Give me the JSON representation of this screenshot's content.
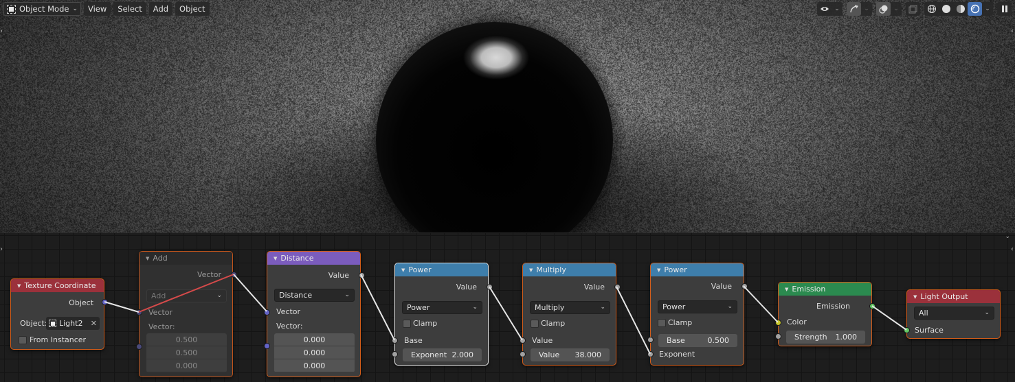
{
  "header": {
    "mode": {
      "label": "Object Mode",
      "icon": "object-mode-icon"
    },
    "menus": [
      "View",
      "Select",
      "Add",
      "Object"
    ]
  },
  "right_tools": {
    "visibility_icon": "eye-selectability-icon",
    "gizmo_icon": "gizmo-icon",
    "overlays_icon": "overlays-icon",
    "xray_icon": "xray-icon",
    "shading_modes": [
      {
        "name": "wireframe",
        "icon": "wireframe-shading-icon",
        "active": false
      },
      {
        "name": "solid",
        "icon": "solid-shading-icon",
        "active": false
      },
      {
        "name": "material-preview",
        "icon": "material-preview-icon",
        "active": false
      },
      {
        "name": "rendered",
        "icon": "rendered-shading-icon",
        "active": true
      }
    ],
    "pause_icon": "pause-icon"
  },
  "colors": {
    "selection_orange": "#d35d1a",
    "input_header": "#9b313b",
    "converter_header": "#3e7eab",
    "vector_header": "#7b5cbd",
    "shader_header": "#2b8a4f",
    "output_header": "#9b313b",
    "socket_vector": "#6363c7",
    "socket_value": "#a1a1a1",
    "socket_color": "#c7c729",
    "socket_shader": "#63c763",
    "active_shading": "#4772b3"
  },
  "nodes": {
    "texture_coordinate": {
      "title": "Texture Coordinate",
      "output": "Object",
      "object_label": "Object:",
      "object_value": "Light2",
      "from_instancer": "From Instancer"
    },
    "add": {
      "title": "Add",
      "output": "Vector",
      "operation": "Add",
      "input1": "Vector",
      "input2_label": "Vector:",
      "input2_values": [
        "0.500",
        "0.500",
        "0.000"
      ]
    },
    "distance": {
      "title": "Distance",
      "output": "Value",
      "operation": "Distance",
      "input1": "Vector",
      "input2_label": "Vector:",
      "input2_values": [
        "0.000",
        "0.000",
        "0.000"
      ]
    },
    "power1": {
      "title": "Power",
      "output": "Value",
      "operation": "Power",
      "clamp": "Clamp",
      "input1": "Base",
      "input2_label": "Exponent",
      "input2_value": "2.000"
    },
    "multiply": {
      "title": "Multiply",
      "output": "Value",
      "operation": "Multiply",
      "clamp": "Clamp",
      "input1": "Value",
      "input2_label": "Value",
      "input2_value": "38.000"
    },
    "power2": {
      "title": "Power",
      "output": "Value",
      "operation": "Power",
      "clamp": "Clamp",
      "input1_label": "Base",
      "input1_value": "0.500",
      "input2": "Exponent"
    },
    "emission": {
      "title": "Emission",
      "output": "Emission",
      "input1": "Color",
      "input2_label": "Strength",
      "input2_value": "1.000"
    },
    "light_output": {
      "title": "Light Output",
      "target": "All",
      "input": "Surface"
    }
  }
}
